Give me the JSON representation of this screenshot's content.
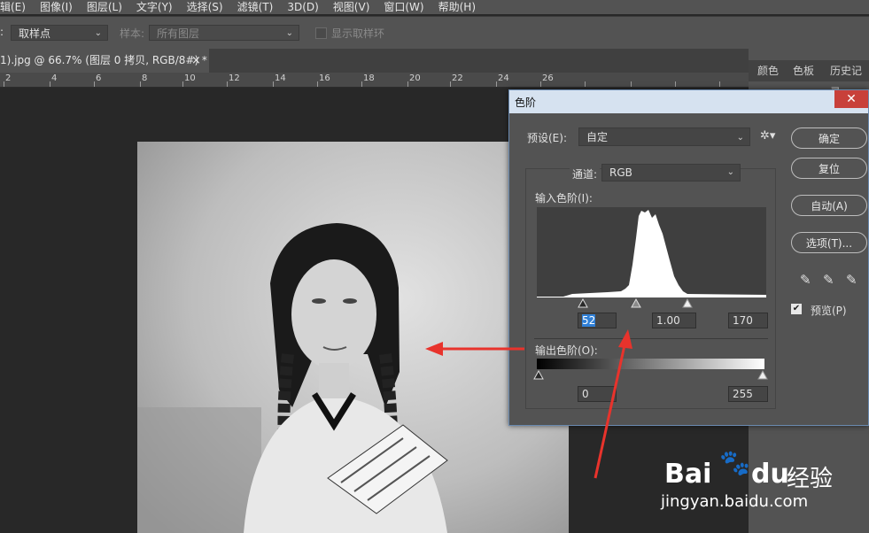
{
  "menu": [
    "编辑(E)",
    "图像(I)",
    "图层(L)",
    "文字(Y)",
    "选择(S)",
    "滤镜(T)",
    "3D(D)",
    "视图(V)",
    "窗口(W)",
    "帮助(H)"
  ],
  "menu_display": [
    "辑(E)",
    "图像(I)",
    "图层(L)",
    "文字(Y)",
    "选择(S)",
    "滤镜(T)",
    "3D(D)",
    "视图(V)",
    "窗口(W)",
    "帮助(H)"
  ],
  "options": {
    "sample_label_suffix": ":",
    "sample_value": "取样点",
    "sample_label2": "样本:",
    "sample2_value": "所有图层",
    "show_ring": "显示取样环"
  },
  "doc_tab": {
    "title": "1).jpg @ 66.7% (图层 0 拷贝, RGB/8#) *",
    "close": "×"
  },
  "ruler_ticks": [
    "2",
    "4",
    "6",
    "8",
    "10",
    "12",
    "14",
    "16",
    "18",
    "20",
    "22",
    "24",
    "26"
  ],
  "right_panel_tabs": [
    "颜色",
    "色板",
    "历史记录"
  ],
  "dialog": {
    "title": "色阶",
    "close": "✕",
    "preset_label": "预设(E):",
    "preset_value": "自定",
    "channel_label": "通道:",
    "channel_value": "RGB",
    "input_label": "输入色阶(I):",
    "input_black": "52",
    "input_gamma": "1.00",
    "input_white": "170",
    "output_label": "输出色阶(O):",
    "output_black": "0",
    "output_white": "255",
    "buttons": {
      "ok": "确定",
      "reset": "复位",
      "auto": "自动(A)",
      "options": "选项(T)..."
    },
    "preview_label": "预览(P)",
    "preview_checked": true
  },
  "watermark": {
    "brand": "Bai",
    "brand2": "du",
    "cn": "经验",
    "url": "jingyan.baidu.com"
  },
  "colors": {
    "arrow": "#e8332c",
    "accent": "#2f7fd6"
  }
}
